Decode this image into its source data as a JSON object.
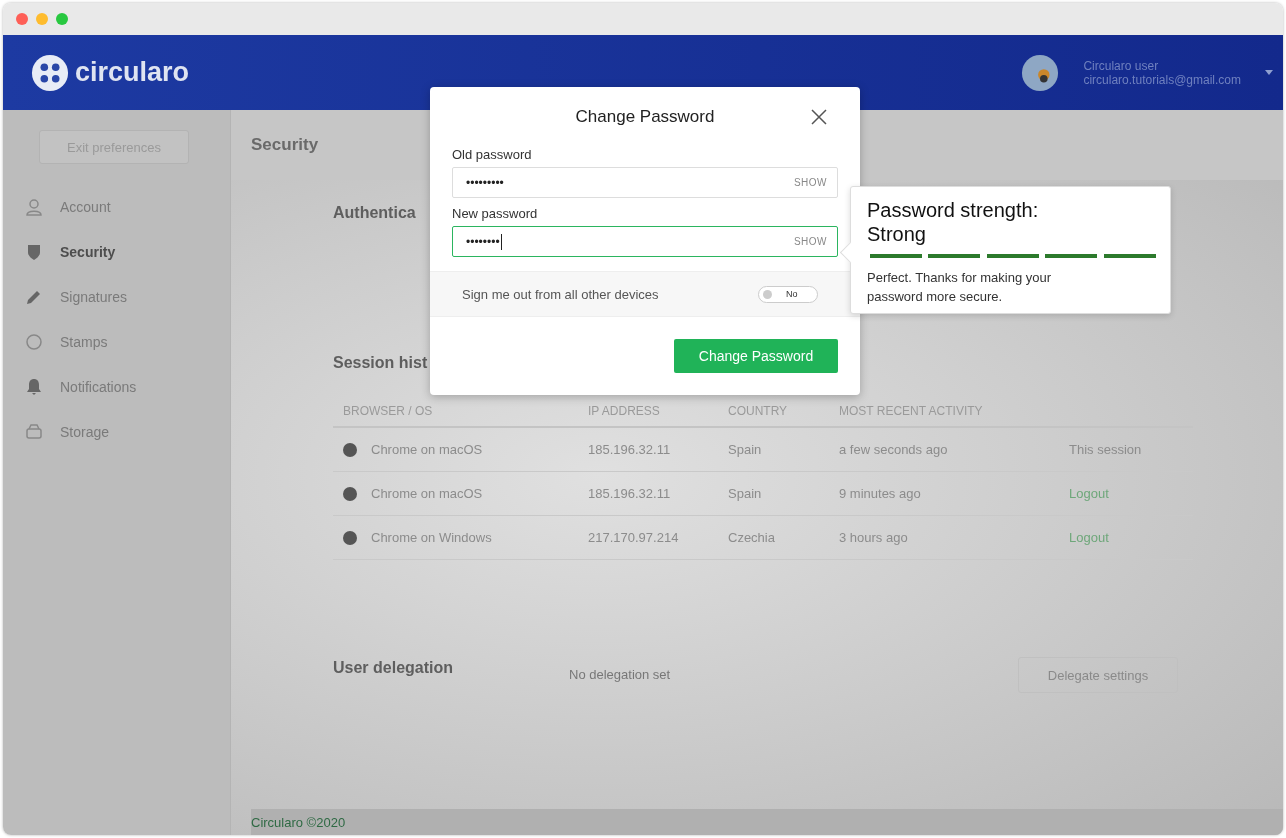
{
  "app": {
    "logo": "circularo",
    "user": {
      "name": "Circularo user",
      "email": "circularo.tutorials@gmail.com"
    }
  },
  "sidebar": {
    "exit_button": "Exit preferences",
    "items": [
      {
        "label": "Account",
        "selected": false
      },
      {
        "label": "Security",
        "selected": true
      },
      {
        "label": "Signatures",
        "selected": false
      },
      {
        "label": "Stamps",
        "selected": false
      },
      {
        "label": "Notifications",
        "selected": false
      },
      {
        "label": "Storage",
        "selected": false
      }
    ]
  },
  "page_title": "Security",
  "authentication": {
    "title": "Authentica"
  },
  "session_history": {
    "title": "Session hist",
    "columns": [
      "BROWSER / OS",
      "IP ADDRESS",
      "COUNTRY",
      "MOST RECENT ACTIVITY"
    ],
    "rows": [
      {
        "browser": "Chrome on macOS",
        "ip": "185.196.32.11",
        "country": "Spain",
        "activity": "a few seconds ago",
        "action": "This session",
        "kind": "current"
      },
      {
        "browser": "Chrome on macOS",
        "ip": "185.196.32.11",
        "country": "Spain",
        "activity": "9 minutes ago",
        "action": "Logout",
        "kind": "logout"
      },
      {
        "browser": "Chrome on Windows",
        "ip": "217.170.97.214",
        "country": "Czechia",
        "activity": "3 hours ago",
        "action": "Logout",
        "kind": "logout"
      }
    ]
  },
  "delegation": {
    "title": "User delegation",
    "status": "No delegation set",
    "button": "Delegate settings"
  },
  "footer": "Circularo ©2020",
  "dialog": {
    "title": "Change Password",
    "fields": [
      {
        "label": "Old password",
        "value": "•••••••••",
        "show": "SHOW",
        "focused": false
      },
      {
        "label": "New password",
        "value": "••••••••",
        "show": "SHOW",
        "focused": true
      }
    ],
    "sign_out": {
      "label": "Sign me out from all other devices",
      "on": false,
      "state": "No"
    },
    "submit": "Change Password"
  },
  "strength": {
    "title": "Password strength: Strong",
    "level": 1,
    "message": "Perfect. Thanks for making your password more secure."
  }
}
